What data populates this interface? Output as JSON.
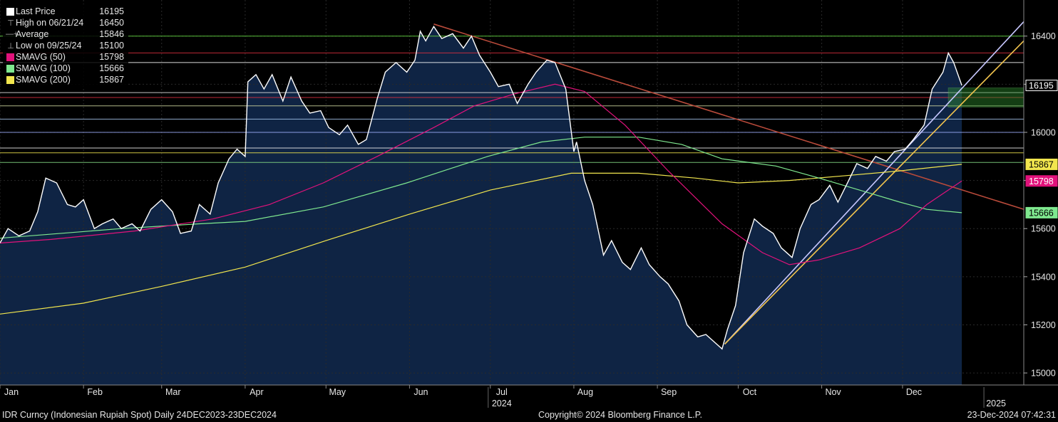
{
  "legend": [
    {
      "label": "Last Price",
      "value": "16195",
      "color": "#ffffff",
      "kind": "swatch"
    },
    {
      "label": "High on 06/21/24",
      "value": "16450",
      "color": "#aaaaaa",
      "kind": "high"
    },
    {
      "label": "Average",
      "value": "15846",
      "color": "#aaaaaa",
      "kind": "avg"
    },
    {
      "label": "Low on 09/25/24",
      "value": "15100",
      "color": "#aaaaaa",
      "kind": "low"
    },
    {
      "label": "SMAVG (50)",
      "value": "15798",
      "color": "#e2127b",
      "kind": "swatch"
    },
    {
      "label": "SMAVG (100)",
      "value": "15666",
      "color": "#7fe88f",
      "kind": "swatch"
    },
    {
      "label": "SMAVG (200)",
      "value": "15867",
      "color": "#f2e64e",
      "kind": "swatch"
    }
  ],
  "footer": {
    "left": "IDR Curncy (Indonesian Rupiah Spot)  Daily 24DEC2023-23DEC2024",
    "center": "Copyright© 2024 Bloomberg Finance L.P.",
    "right": "23-Dec-2024 07:42:31"
  },
  "chart_data": {
    "type": "line",
    "ylim": [
      14950,
      16550
    ],
    "yticks": [
      15000,
      15200,
      15400,
      15600,
      15800,
      16000,
      16200,
      16400
    ],
    "ytick_labels": [
      "15000",
      "15200",
      "15400",
      "15600",
      "15800",
      "16000",
      "16200",
      "16400"
    ],
    "x_range": [
      "2024-01-01",
      "2025-01-15"
    ],
    "xticks": [
      {
        "date": "2024-01-01",
        "label": "Jan"
      },
      {
        "date": "2024-02-01",
        "label": "Feb"
      },
      {
        "date": "2024-03-01",
        "label": "Mar"
      },
      {
        "date": "2024-04-01",
        "label": "Apr"
      },
      {
        "date": "2024-05-01",
        "label": "May"
      },
      {
        "date": "2024-06-01",
        "label": "Jun"
      },
      {
        "date": "2024-07-01",
        "label": "Jul"
      },
      {
        "date": "2024-08-01",
        "label": "Aug"
      },
      {
        "date": "2024-09-01",
        "label": "Sep"
      },
      {
        "date": "2024-10-01",
        "label": "Oct"
      },
      {
        "date": "2024-11-01",
        "label": "Nov"
      },
      {
        "date": "2024-12-01",
        "label": "Dec"
      }
    ],
    "year_labels": [
      {
        "date": "2024-07-01",
        "label": "2024"
      },
      {
        "date": "2025-01-01",
        "label": "2025"
      }
    ],
    "price_labels": [
      {
        "value": 16195,
        "label": "16195",
        "bg": "#000000",
        "fg": "#ffffff",
        "border": "#ffffff"
      },
      {
        "value": 15867,
        "label": "15867",
        "bg": "#f2e64e",
        "fg": "#000000",
        "border": "#f2e64e"
      },
      {
        "value": 15798,
        "label": "15798",
        "bg": "#e2127b",
        "fg": "#ffffff",
        "border": "#e2127b"
      },
      {
        "value": 15666,
        "label": "15666",
        "bg": "#7fe88f",
        "fg": "#000000",
        "border": "#7fe88f"
      }
    ],
    "h_levels": [
      {
        "value": 16400,
        "color": "#66dd44"
      },
      {
        "value": 16330,
        "color": "#e03040"
      },
      {
        "value": 16290,
        "color": "#ffffff"
      },
      {
        "value": 16165,
        "color": "#e6e6e6"
      },
      {
        "value": 16145,
        "color": "#e03040"
      },
      {
        "value": 16110,
        "color": "#cfd8a0"
      },
      {
        "value": 16055,
        "color": "#a8c8f0"
      },
      {
        "value": 16000,
        "color": "#a0b0ff"
      },
      {
        "value": 15935,
        "color": "#f2f2f2"
      },
      {
        "value": 15915,
        "color": "#f2e64e"
      },
      {
        "value": 15875,
        "color": "#88dd88"
      }
    ],
    "zone": {
      "x1": "2024-12-18",
      "x2": "2025-01-15",
      "y1": 16185,
      "y2": 16105,
      "color": "#2e8a2e"
    },
    "trendlines": [
      {
        "x1": "2024-06-10",
        "y1": 16450,
        "x2": "2025-01-15",
        "y2": 15680,
        "color": "#b84a3a"
      },
      {
        "x1": "2024-09-26",
        "y1": 15120,
        "x2": "2025-01-15",
        "y2": 16460,
        "color": "#c8c8ff"
      },
      {
        "x1": "2024-09-26",
        "y1": 15120,
        "x2": "2025-01-15",
        "y2": 16380,
        "color": "#f2c44e"
      }
    ],
    "series": [
      {
        "name": "Last Price",
        "color": "#ffffff",
        "fill": "#0f2444",
        "points": [
          [
            "2024-01-01",
            15540
          ],
          [
            "2024-01-04",
            15600
          ],
          [
            "2024-01-08",
            15570
          ],
          [
            "2024-01-12",
            15590
          ],
          [
            "2024-01-15",
            15670
          ],
          [
            "2024-01-18",
            15810
          ],
          [
            "2024-01-22",
            15790
          ],
          [
            "2024-01-26",
            15700
          ],
          [
            "2024-01-29",
            15690
          ],
          [
            "2024-02-01",
            15720
          ],
          [
            "2024-02-05",
            15600
          ],
          [
            "2024-02-08",
            15620
          ],
          [
            "2024-02-12",
            15640
          ],
          [
            "2024-02-15",
            15600
          ],
          [
            "2024-02-19",
            15620
          ],
          [
            "2024-02-22",
            15590
          ],
          [
            "2024-02-26",
            15680
          ],
          [
            "2024-03-01",
            15720
          ],
          [
            "2024-03-05",
            15670
          ],
          [
            "2024-03-08",
            15580
          ],
          [
            "2024-03-12",
            15590
          ],
          [
            "2024-03-15",
            15700
          ],
          [
            "2024-03-19",
            15660
          ],
          [
            "2024-03-22",
            15790
          ],
          [
            "2024-03-26",
            15890
          ],
          [
            "2024-03-29",
            15930
          ],
          [
            "2024-04-01",
            15900
          ],
          [
            "2024-04-02",
            16210
          ],
          [
            "2024-04-05",
            16240
          ],
          [
            "2024-04-08",
            16180
          ],
          [
            "2024-04-11",
            16240
          ],
          [
            "2024-04-15",
            16130
          ],
          [
            "2024-04-18",
            16230
          ],
          [
            "2024-04-22",
            16130
          ],
          [
            "2024-04-25",
            16080
          ],
          [
            "2024-04-29",
            16090
          ],
          [
            "2024-05-02",
            16020
          ],
          [
            "2024-05-06",
            15990
          ],
          [
            "2024-05-09",
            16030
          ],
          [
            "2024-05-13",
            15950
          ],
          [
            "2024-05-16",
            15970
          ],
          [
            "2024-05-20",
            16140
          ],
          [
            "2024-05-23",
            16250
          ],
          [
            "2024-05-27",
            16290
          ],
          [
            "2024-05-31",
            16250
          ],
          [
            "2024-06-03",
            16300
          ],
          [
            "2024-06-05",
            16420
          ],
          [
            "2024-06-07",
            16380
          ],
          [
            "2024-06-10",
            16440
          ],
          [
            "2024-06-13",
            16390
          ],
          [
            "2024-06-17",
            16410
          ],
          [
            "2024-06-21",
            16350
          ],
          [
            "2024-06-24",
            16400
          ],
          [
            "2024-06-27",
            16320
          ],
          [
            "2024-07-01",
            16250
          ],
          [
            "2024-07-04",
            16190
          ],
          [
            "2024-07-08",
            16200
          ],
          [
            "2024-07-11",
            16120
          ],
          [
            "2024-07-15",
            16200
          ],
          [
            "2024-07-18",
            16250
          ],
          [
            "2024-07-22",
            16300
          ],
          [
            "2024-07-25",
            16290
          ],
          [
            "2024-07-29",
            16180
          ],
          [
            "2024-08-01",
            15920
          ],
          [
            "2024-08-02",
            15960
          ],
          [
            "2024-08-05",
            15800
          ],
          [
            "2024-08-08",
            15700
          ],
          [
            "2024-08-12",
            15490
          ],
          [
            "2024-08-15",
            15550
          ],
          [
            "2024-08-19",
            15460
          ],
          [
            "2024-08-22",
            15430
          ],
          [
            "2024-08-26",
            15520
          ],
          [
            "2024-08-29",
            15450
          ],
          [
            "2024-09-02",
            15400
          ],
          [
            "2024-09-05",
            15370
          ],
          [
            "2024-09-09",
            15300
          ],
          [
            "2024-09-12",
            15200
          ],
          [
            "2024-09-16",
            15150
          ],
          [
            "2024-09-19",
            15160
          ],
          [
            "2024-09-23",
            15120
          ],
          [
            "2024-09-25",
            15100
          ],
          [
            "2024-09-27",
            15180
          ],
          [
            "2024-09-30",
            15280
          ],
          [
            "2024-10-03",
            15500
          ],
          [
            "2024-10-07",
            15640
          ],
          [
            "2024-10-10",
            15610
          ],
          [
            "2024-10-14",
            15580
          ],
          [
            "2024-10-17",
            15520
          ],
          [
            "2024-10-21",
            15480
          ],
          [
            "2024-10-24",
            15600
          ],
          [
            "2024-10-28",
            15700
          ],
          [
            "2024-10-31",
            15720
          ],
          [
            "2024-11-04",
            15780
          ],
          [
            "2024-11-07",
            15710
          ],
          [
            "2024-11-11",
            15800
          ],
          [
            "2024-11-14",
            15870
          ],
          [
            "2024-11-18",
            15850
          ],
          [
            "2024-11-21",
            15900
          ],
          [
            "2024-11-25",
            15880
          ],
          [
            "2024-11-28",
            15920
          ],
          [
            "2024-12-02",
            15930
          ],
          [
            "2024-12-05",
            15970
          ],
          [
            "2024-12-09",
            16030
          ],
          [
            "2024-12-12",
            16180
          ],
          [
            "2024-12-16",
            16250
          ],
          [
            "2024-12-18",
            16330
          ],
          [
            "2024-12-20",
            16290
          ],
          [
            "2024-12-23",
            16195
          ]
        ]
      },
      {
        "name": "SMAVG (50)",
        "color": "#e2127b",
        "points": [
          [
            "2024-01-01",
            15540
          ],
          [
            "2024-01-20",
            15555
          ],
          [
            "2024-02-20",
            15590
          ],
          [
            "2024-03-20",
            15640
          ],
          [
            "2024-04-10",
            15700
          ],
          [
            "2024-04-30",
            15790
          ],
          [
            "2024-05-20",
            15900
          ],
          [
            "2024-06-10",
            16020
          ],
          [
            "2024-06-25",
            16110
          ],
          [
            "2024-07-10",
            16160
          ],
          [
            "2024-07-25",
            16200
          ],
          [
            "2024-08-05",
            16170
          ],
          [
            "2024-08-20",
            16030
          ],
          [
            "2024-09-05",
            15840
          ],
          [
            "2024-09-25",
            15620
          ],
          [
            "2024-10-10",
            15500
          ],
          [
            "2024-10-20",
            15450
          ],
          [
            "2024-10-31",
            15470
          ],
          [
            "2024-11-15",
            15520
          ],
          [
            "2024-11-30",
            15600
          ],
          [
            "2024-12-10",
            15700
          ],
          [
            "2024-12-23",
            15798
          ]
        ]
      },
      {
        "name": "SMAVG (100)",
        "color": "#7fe88f",
        "points": [
          [
            "2024-01-01",
            15560
          ],
          [
            "2024-02-15",
            15600
          ],
          [
            "2024-03-15",
            15620
          ],
          [
            "2024-04-01",
            15630
          ],
          [
            "2024-04-30",
            15690
          ],
          [
            "2024-05-31",
            15790
          ],
          [
            "2024-06-30",
            15900
          ],
          [
            "2024-07-20",
            15960
          ],
          [
            "2024-08-05",
            15980
          ],
          [
            "2024-08-25",
            15980
          ],
          [
            "2024-09-10",
            15950
          ],
          [
            "2024-09-25",
            15890
          ],
          [
            "2024-10-15",
            15860
          ],
          [
            "2024-10-31",
            15810
          ],
          [
            "2024-11-15",
            15760
          ],
          [
            "2024-11-30",
            15710
          ],
          [
            "2024-12-10",
            15680
          ],
          [
            "2024-12-23",
            15666
          ]
        ]
      },
      {
        "name": "SMAVG (200)",
        "color": "#f2e64e",
        "points": [
          [
            "2024-01-01",
            15245
          ],
          [
            "2024-02-01",
            15290
          ],
          [
            "2024-03-01",
            15360
          ],
          [
            "2024-04-01",
            15440
          ],
          [
            "2024-05-01",
            15550
          ],
          [
            "2024-06-01",
            15660
          ],
          [
            "2024-07-01",
            15760
          ],
          [
            "2024-07-31",
            15830
          ],
          [
            "2024-08-25",
            15830
          ],
          [
            "2024-09-15",
            15810
          ],
          [
            "2024-10-01",
            15790
          ],
          [
            "2024-10-20",
            15800
          ],
          [
            "2024-11-10",
            15820
          ],
          [
            "2024-11-30",
            15840
          ],
          [
            "2024-12-23",
            15867
          ]
        ]
      }
    ]
  }
}
